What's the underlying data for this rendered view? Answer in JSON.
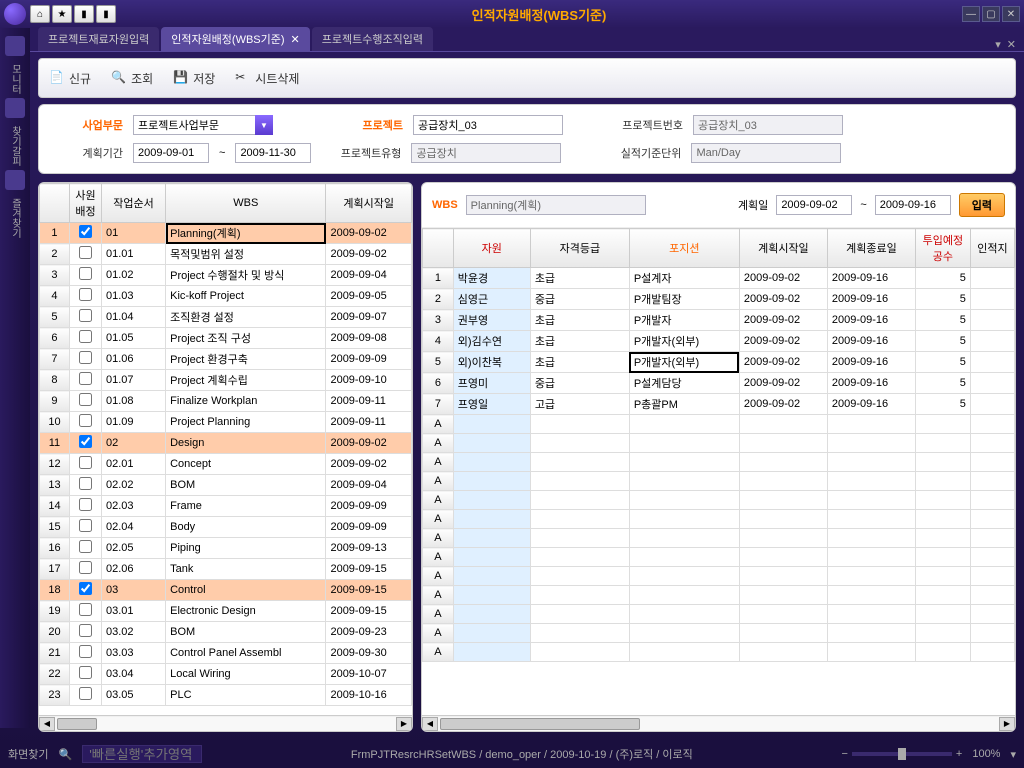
{
  "titlebar": {
    "title": "인적자원배정(WBS기준)"
  },
  "tabs": [
    {
      "label": "프로젝트재료자원입력",
      "active": false
    },
    {
      "label": "인적자원배정(WBS기준)",
      "active": true
    },
    {
      "label": "프로젝트수행조직입력",
      "active": false
    }
  ],
  "sidebar": {
    "items": [
      "모니터",
      "찾기갈피",
      "즐겨찾기"
    ]
  },
  "toolbar": {
    "new": "신규",
    "query": "조회",
    "save": "저장",
    "delete": "시트삭제"
  },
  "filter": {
    "biz_label": "사업부문",
    "biz_value": "프로젝트사업부문",
    "project_label": "프로젝트",
    "project_value": "공급장치_03",
    "projectno_label": "프로젝트번호",
    "projectno_value": "공급장치_03",
    "period_label": "계획기간",
    "period_from": "2009-09-01",
    "period_to": "2009-11-30",
    "tilde": "~",
    "ptype_label": "프로젝트유형",
    "ptype_value": "공급장치",
    "unit_label": "실적기준단위",
    "unit_value": "Man/Day"
  },
  "wbsbar": {
    "wbs_label": "WBS",
    "wbs_value": "Planning(계획)",
    "date_label": "계획일",
    "date_from": "2009-09-02",
    "date_to": "2009-09-16",
    "tilde": "~",
    "btn": "입력"
  },
  "left_grid": {
    "headers": {
      "h1": "사원배정",
      "h2": "작업순서",
      "h3": "WBS",
      "h4": "계획시작일"
    },
    "rows": [
      {
        "n": "1",
        "chk": true,
        "seq": "01",
        "wbs": "Planning(계획)",
        "date": "2009-09-02",
        "hl": true,
        "sel": true
      },
      {
        "n": "2",
        "chk": false,
        "seq": "01.01",
        "wbs": "목적및범위 설정",
        "date": "2009-09-02"
      },
      {
        "n": "3",
        "chk": false,
        "seq": "01.02",
        "wbs": "Project 수행절차 및 방식",
        "date": "2009-09-04"
      },
      {
        "n": "4",
        "chk": false,
        "seq": "01.03",
        "wbs": "Kic-koff Project",
        "date": "2009-09-05"
      },
      {
        "n": "5",
        "chk": false,
        "seq": "01.04",
        "wbs": "조직환경 설정",
        "date": "2009-09-07"
      },
      {
        "n": "6",
        "chk": false,
        "seq": "01.05",
        "wbs": "Project 조직 구성",
        "date": "2009-09-08"
      },
      {
        "n": "7",
        "chk": false,
        "seq": "01.06",
        "wbs": "Project 환경구축",
        "date": "2009-09-09"
      },
      {
        "n": "8",
        "chk": false,
        "seq": "01.07",
        "wbs": "Project 계획수립",
        "date": "2009-09-10"
      },
      {
        "n": "9",
        "chk": false,
        "seq": "01.08",
        "wbs": "Finalize Workplan",
        "date": "2009-09-11"
      },
      {
        "n": "10",
        "chk": false,
        "seq": "01.09",
        "wbs": "Project Planning",
        "date": "2009-09-11"
      },
      {
        "n": "11",
        "chk": true,
        "seq": "02",
        "wbs": "Design",
        "date": "2009-09-02",
        "hl": true
      },
      {
        "n": "12",
        "chk": false,
        "seq": "02.01",
        "wbs": "Concept",
        "date": "2009-09-02"
      },
      {
        "n": "13",
        "chk": false,
        "seq": "02.02",
        "wbs": "BOM",
        "date": "2009-09-04"
      },
      {
        "n": "14",
        "chk": false,
        "seq": "02.03",
        "wbs": "Frame",
        "date": "2009-09-09"
      },
      {
        "n": "15",
        "chk": false,
        "seq": "02.04",
        "wbs": "Body",
        "date": "2009-09-09"
      },
      {
        "n": "16",
        "chk": false,
        "seq": "02.05",
        "wbs": "Piping",
        "date": "2009-09-13"
      },
      {
        "n": "17",
        "chk": false,
        "seq": "02.06",
        "wbs": "Tank",
        "date": "2009-09-15"
      },
      {
        "n": "18",
        "chk": true,
        "seq": "03",
        "wbs": "Control",
        "date": "2009-09-15",
        "hl": true
      },
      {
        "n": "19",
        "chk": false,
        "seq": "03.01",
        "wbs": "Electronic Design",
        "date": "2009-09-15"
      },
      {
        "n": "20",
        "chk": false,
        "seq": "03.02",
        "wbs": "BOM",
        "date": "2009-09-23"
      },
      {
        "n": "21",
        "chk": false,
        "seq": "03.03",
        "wbs": "Control Panel Assembl",
        "date": "2009-09-30"
      },
      {
        "n": "22",
        "chk": false,
        "seq": "03.04",
        "wbs": "Local Wiring",
        "date": "2009-10-07"
      },
      {
        "n": "23",
        "chk": false,
        "seq": "03.05",
        "wbs": "PLC",
        "date": "2009-10-16"
      }
    ]
  },
  "right_grid": {
    "headers": {
      "h1": "자원",
      "h2": "자격등급",
      "h3": "포지션",
      "h4": "계획시작일",
      "h5": "계획종료일",
      "h6": "투입예정공수",
      "h7": "인적지"
    },
    "rows": [
      {
        "n": "1",
        "res": "박윤경",
        "grade": "초급",
        "pos": "P설계자",
        "sd": "2009-09-02",
        "ed": "2009-09-16",
        "mh": "5"
      },
      {
        "n": "2",
        "res": "심영근",
        "grade": "중급",
        "pos": "P개발팀장",
        "sd": "2009-09-02",
        "ed": "2009-09-16",
        "mh": "5"
      },
      {
        "n": "3",
        "res": "권부영",
        "grade": "초급",
        "pos": "P개발자",
        "sd": "2009-09-02",
        "ed": "2009-09-16",
        "mh": "5"
      },
      {
        "n": "4",
        "res": "외)김수연",
        "grade": "초급",
        "pos": "P개발자(외부)",
        "sd": "2009-09-02",
        "ed": "2009-09-16",
        "mh": "5"
      },
      {
        "n": "5",
        "res": "외)이찬복",
        "grade": "초급",
        "pos": "P개발자(외부)",
        "sd": "2009-09-02",
        "ed": "2009-09-16",
        "mh": "5",
        "sel": true
      },
      {
        "n": "6",
        "res": "프영미",
        "grade": "중급",
        "pos": "P설계담당",
        "sd": "2009-09-02",
        "ed": "2009-09-16",
        "mh": "5"
      },
      {
        "n": "7",
        "res": "프영일",
        "grade": "고급",
        "pos": "P총괄PM",
        "sd": "2009-09-02",
        "ed": "2009-09-16",
        "mh": "5"
      }
    ],
    "empty_label": "A"
  },
  "status": {
    "left_label": "화면찾기",
    "placeholder": "'빠른실행'추가영역",
    "center": "FrmPJTResrcHRSetWBS / demo_oper / 2009-10-19 / (주)로직 / 이로직",
    "zoom": "100%"
  }
}
